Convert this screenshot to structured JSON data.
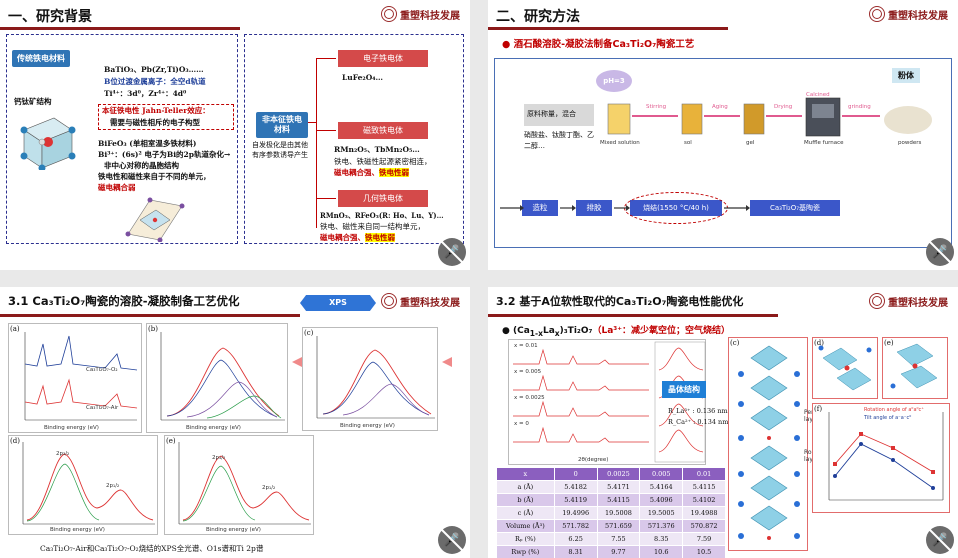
{
  "logo_text": "重塑科技发展",
  "slide1": {
    "title": "一、研究背景",
    "tag_traditional": "传统铁电材料",
    "perovskite_label": "钙钛矿结构",
    "formula_line": "BaTiO₃、Pb(Zr,Ti)O₃……",
    "b_site_note": "B位过渡金属离子：全空d轨道",
    "ions_line": "Ti⁴⁺：3d⁰，Zr⁴⁺：4d⁰",
    "jahn_teller": "本征铁电性 Jahn-Teller效应：",
    "jahn_teller_2": "需要与磁性相斥的电子构型",
    "bifeo3": "BiFeO₃ (单相室温多铁材料)",
    "bi_line": "Bi³⁺：(6s)² 电子为Bi的2p轨道杂化→",
    "bi_line_2": "非中心对称的晶胞结构",
    "unit_line": "铁电性和磁性来自于不同的单元，",
    "coupling": "磁电耦合弱",
    "tag_improper": "非本征铁电材料",
    "improper_note": "自发极化是由其他有序参数诱导产生",
    "improper_note_hl": "有序参数",
    "cat1": "电子铁电体",
    "cat1_example": "LuFe₂O₄…",
    "cat2": "磁致铁电体",
    "cat2_example": "RMn₂O₅、TbMn₂O₅…",
    "cat2_note": "铁电、铁磁性起源紧密相连，",
    "cat2_note_red": "磁电耦合强、",
    "cat2_note_hl": "铁电性弱",
    "cat3": "几何铁电体",
    "cat3_example": "RMnO₃、RFeO₃(R: Ho、Lu、Y)…",
    "cat3_note": "铁电、磁性来自同一结构单元，",
    "cat3_note_red": "磁电耦合强、",
    "cat3_note_hl": "铁电性弱"
  },
  "slide2": {
    "title": "二、研究方法",
    "subtitle": "酒石酸溶胶-凝胶法制备Ca₃Ti₂O₇陶瓷工艺",
    "ph": "pH=3",
    "raw_label": "原料称量，混合",
    "raw_list": "硝酸盐、钛酸丁酯、乙二醇…",
    "stir": "Stirring",
    "aging": "Aging",
    "drying": "Drying",
    "calcined": "Calcined",
    "grinding": "grinding",
    "mixed": "Mixed solution",
    "sol": "sol",
    "gel": "gel",
    "furnace": "Muffle furnace",
    "powders": "powders",
    "powder_tag": "粉体",
    "step1": "造粒",
    "step2": "排胶",
    "step3": "烧结(1550 °C/40 h)",
    "step4": "Ca₃Ti₂O₇基陶瓷"
  },
  "slide3": {
    "title": "3.1 Ca₃Ti₂O₇陶瓷的溶胶-凝胶制备工艺优化",
    "xps_tag": "XPS",
    "caption": "Ca₃Ti₂O₇-Air和Ca₃Ti₂O₇-O₂烧结的XPS全光谱、O1s谱和Ti 2p谱",
    "panel_a": "(a)",
    "panel_b": "(b)",
    "panel_c": "(c)",
    "panel_d": "(d)",
    "panel_e": "(e)",
    "xlabel": "Binding energy (eV)",
    "ylabel": "Intensity (a.u.)",
    "a_series_1": "Ca₃Ti₂O₇-O₂",
    "a_series_2": "Ca₃Ti₂O₇-Air",
    "ti_peak_1": "2p₃/₂",
    "ti_peak_2": "2p₁/₂"
  },
  "slide4": {
    "title": "3.2 基于A位软性取代的Ca₃Ti₂O₇陶瓷电性能优化",
    "formula_prefix": "(Ca",
    "formula_la": "La",
    "formula_suffix": ")₃Ti₂O₇",
    "formula_note": "（La³⁺：减少氧空位；空气烧结）",
    "crystal_tag": "晶体结构",
    "r_la": "R_La³⁺ : 0.136 nm",
    "r_ca": "R_Ca²⁺ : 0.134 nm",
    "xrd_xlabel": "2θ(degree)",
    "panel_c": "(c)",
    "panel_d": "(d)",
    "panel_e": "(e)",
    "panel_f": "(f)",
    "perovskite_layer": "Perovskite layer",
    "rocksalt_layer": "Rock salt layer",
    "f_legend_1": "Rotation angle of a⁰a⁰c⁺",
    "f_legend_2": "Tilt angle of a⁻a⁻c⁰",
    "xrd_labels": [
      "x = 0.01",
      "x = 0.005",
      "x = 0.0025",
      "x = 0"
    ],
    "table_header": [
      "x",
      "0",
      "0.0025",
      "0.005",
      "0.01"
    ],
    "table_rows": [
      [
        "a (Å)",
        "5.4182",
        "5.4171",
        "5.4164",
        "5.4115"
      ],
      [
        "b (Å)",
        "5.4119",
        "5.4115",
        "5.4096",
        "5.4102"
      ],
      [
        "c (Å)",
        "19.4996",
        "19.5008",
        "19.5005",
        "19.4988"
      ],
      [
        "Volume (Å³)",
        "571.782",
        "571.659",
        "571.376",
        "570.872"
      ],
      [
        "Rₚ (%)",
        "6.25",
        "7.55",
        "8.35",
        "7.59"
      ],
      [
        "Rwp (%)",
        "8.31",
        "9.77",
        "10.6",
        "10.5"
      ],
      [
        "χ²",
        "2.55",
        "2.09",
        "2.51",
        "4.2"
      ]
    ]
  }
}
